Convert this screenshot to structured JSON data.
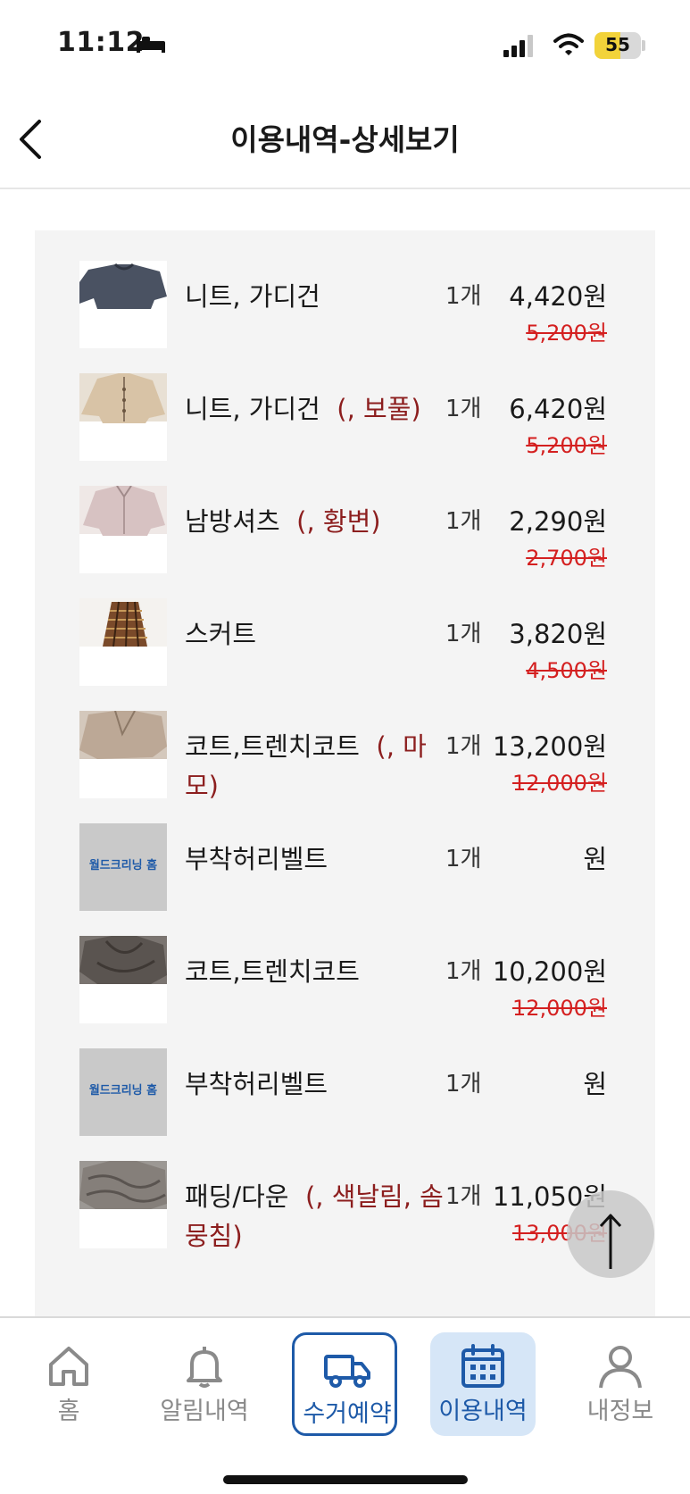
{
  "status_bar": {
    "time": "11:12",
    "battery_level": "55",
    "battery_fraction": 0.55
  },
  "header": {
    "title": "이용내역-상세보기"
  },
  "items": [
    {
      "name": "니트, 가디건",
      "defect": "",
      "qty": "1개",
      "price": "4,420원",
      "original": "5,200원",
      "thumb": "gray-sweater"
    },
    {
      "name": "니트, 가디건",
      "defect": "(, 보풀)",
      "qty": "1개",
      "price": "6,420원",
      "original": "5,200원",
      "thumb": "beige-cardigan"
    },
    {
      "name": "남방셔츠",
      "defect": "(, 황변)",
      "qty": "1개",
      "price": "2,290원",
      "original": "2,700원",
      "thumb": "pink-shirt"
    },
    {
      "name": "스커트",
      "defect": "",
      "qty": "1개",
      "price": "3,820원",
      "original": "4,500원",
      "thumb": "check-skirt"
    },
    {
      "name": "코트,트렌치코트",
      "defect": "(, 마모)",
      "qty": "1개",
      "price": "13,200원",
      "original": "12,000원",
      "thumb": "beige-coat"
    },
    {
      "name": "부착허리벨트",
      "defect": "",
      "qty": "1개",
      "price": "원",
      "original": "",
      "thumb": "logo",
      "logo_text": "월드크리닝 홈"
    },
    {
      "name": "코트,트렌치코트",
      "defect": "",
      "qty": "1개",
      "price": "10,200원",
      "original": "12,000원",
      "thumb": "dark-coat"
    },
    {
      "name": "부착허리벨트",
      "defect": "",
      "qty": "1개",
      "price": "원",
      "original": "",
      "thumb": "logo",
      "logo_text": "월드크리닝 홈"
    },
    {
      "name": "패딩/다운",
      "defect": "(, 색날림, 솜뭉침)",
      "qty": "1개",
      "price": "11,050원",
      "original": "13,000원",
      "thumb": "gray-padding"
    }
  ],
  "tabbar": {
    "home": "홈",
    "alerts": "알림내역",
    "pickup": "수거예약",
    "history": "이용내역",
    "myinfo": "내정보"
  },
  "colors": {
    "accent": "#1e5aa8",
    "strike_price": "#d42020",
    "defect": "#8c1e1e",
    "active_tab_bg": "#d6e6f7"
  }
}
